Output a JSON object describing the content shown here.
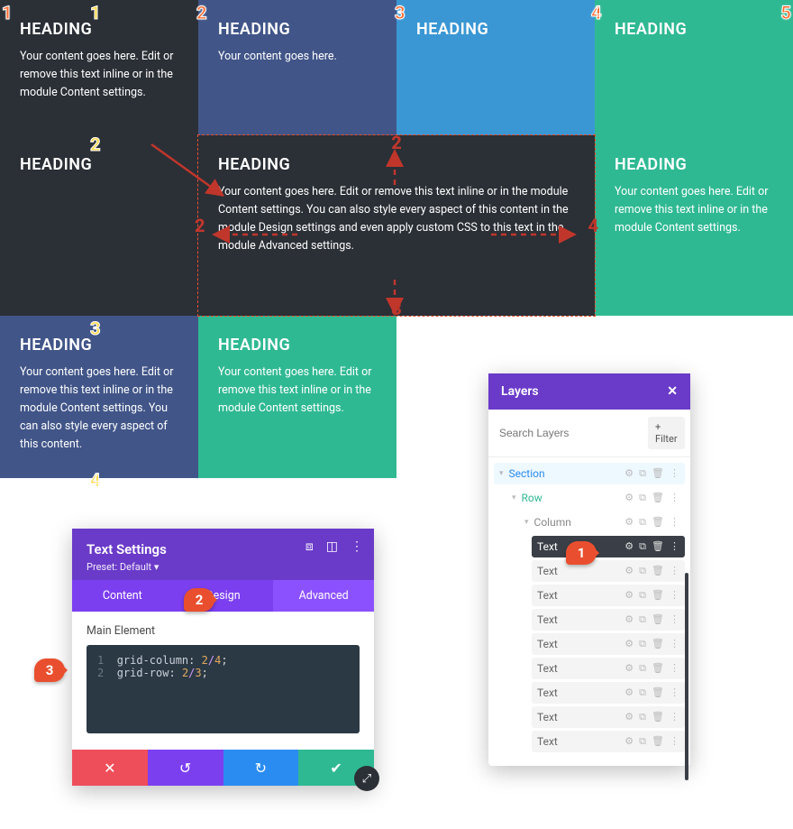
{
  "grid": {
    "col_lines": [
      "1",
      "2",
      "3",
      "4",
      "5"
    ],
    "row_lines": [
      "1",
      "2",
      "3",
      "4"
    ],
    "cells": [
      {
        "heading": "HEADING",
        "body": "Your content goes here. Edit or remove this text inline or in the module Content settings."
      },
      {
        "heading": "HEADING",
        "body": "Your content goes here."
      },
      {
        "heading": "HEADING",
        "body": ""
      },
      {
        "heading": "HEADING",
        "body": ""
      },
      {
        "heading": "HEADING",
        "body": ""
      },
      {
        "heading": "HEADING",
        "body": "Your content goes here. Edit or remove this text inline or in the module Content settings. You can also style every aspect of this content in the module Design settings and even apply custom CSS to this text in the module Advanced settings."
      },
      {
        "heading": "HEADING",
        "body": "Your content goes here. Edit or remove this text inline or in the module Content settings."
      },
      {
        "heading": "HEADING",
        "body": "Your content goes here. Edit or remove this text inline or in the module Content settings. You can also style every aspect of this content."
      },
      {
        "heading": "HEADING",
        "body": "Your content goes here. Edit or remove this text inline or in the module Content settings."
      }
    ],
    "span_annotations": {
      "top": "2",
      "left": "2",
      "right": "4",
      "bottom": "3"
    }
  },
  "settings": {
    "title": "Text Settings",
    "preset_label": "Preset: Default",
    "tabs": [
      "Content",
      "Design",
      "Advanced"
    ],
    "active_tab": "Advanced",
    "section_label": "Main Element",
    "code_lines": [
      {
        "n": "1",
        "prop": "grid-column",
        "valA": "2",
        "sep": "/",
        "valB": "4"
      },
      {
        "n": "2",
        "prop": "grid-row",
        "valA": "2",
        "sep": "/",
        "valB": "3"
      }
    ],
    "callouts": {
      "tab": "2",
      "code": "3"
    }
  },
  "layers": {
    "title": "Layers",
    "search_placeholder": "Search Layers",
    "filter_label": "+ Filter",
    "section": "Section",
    "row": "Row",
    "column": "Column",
    "text_label": "Text",
    "text_items_count": 9,
    "active_text_index": 0,
    "callout": "1"
  }
}
